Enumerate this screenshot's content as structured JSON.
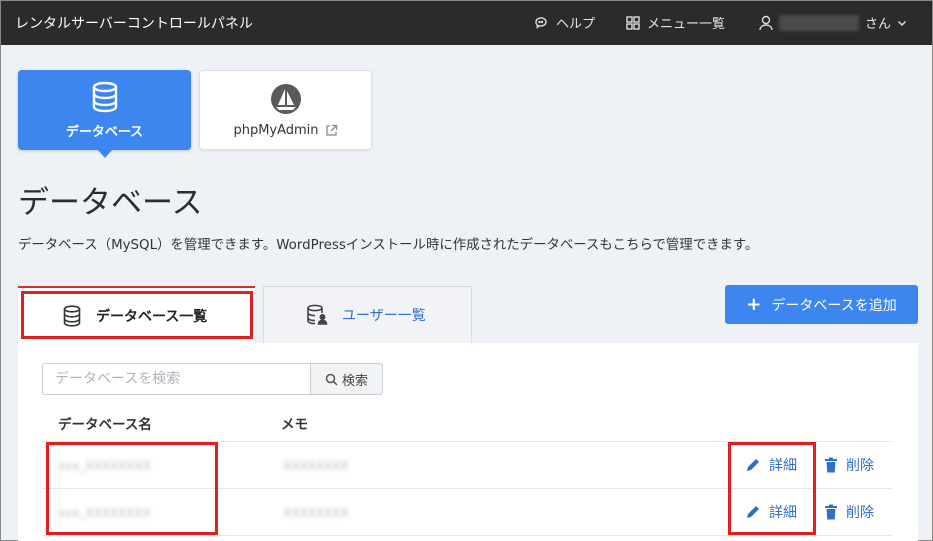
{
  "header": {
    "title": "レンタルサーバーコントロールパネル",
    "help": "ヘルプ",
    "menu": "メニュー一覧",
    "user_suffix": "さん",
    "user_name_masked": "XXXXXXXX"
  },
  "apps": [
    {
      "label": "データベース",
      "icon": "database-icon",
      "active": true
    },
    {
      "label": "phpMyAdmin",
      "icon": "sailboat-icon",
      "external": true
    }
  ],
  "page": {
    "title": "データベース",
    "description": "データベース（MySQL）を管理できます。WordPressインストール時に作成されたデータベースもこちらで管理できます。"
  },
  "tabs": [
    {
      "label": "データベース一覧",
      "active": true,
      "icon": "database-icon"
    },
    {
      "label": "ユーザー一覧",
      "active": false,
      "icon": "database-user-icon"
    }
  ],
  "add_button": {
    "label": "データベースを追加"
  },
  "search": {
    "placeholder": "データベースを検索",
    "button": "検索"
  },
  "table": {
    "columns": [
      "データベース名",
      "メモ"
    ],
    "rows": [
      {
        "name": "xxx_XXXXXXXX",
        "memo": "XXXXXXXX"
      },
      {
        "name": "xxx_XXXXXXXX",
        "memo": "XXXXXXXX"
      }
    ],
    "detail_label": "詳細",
    "delete_label": "削除"
  },
  "colors": {
    "accent": "#3d86f0",
    "header_bg": "#2b2b2b",
    "highlight": "#e02020",
    "link": "#2f6fc7"
  }
}
